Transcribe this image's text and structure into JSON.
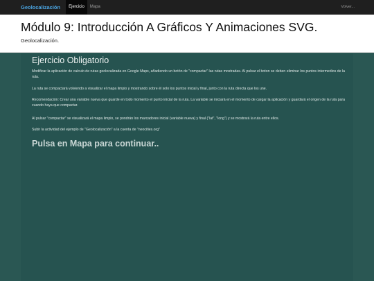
{
  "navbar": {
    "brand": "Geolocalización",
    "tabs": [
      {
        "label": "Ejercicio",
        "active": true
      },
      {
        "label": "Mapa",
        "active": false
      }
    ],
    "right_link": "Volver..."
  },
  "header": {
    "title": "Módulo 9: Introducción A Gráficos Y Animaciones SVG.",
    "subtitle": "Geolocalización."
  },
  "exercise": {
    "title": "Ejercicio Obligatorio",
    "paragraphs": [
      "Modificar la aplicación de calculo de rutas geolocalizada en Google Maps, añadiendo un botón de \"compactar\" las rutas mostradas. Al pulsar el boton se deben eliminar los puntos intermedios de la ruta.",
      "La ruta se compactará volviendo a visualizar el mapa limpio y mostrando sobre él solo los puntos inicial y final, junto con la ruta directa que los une.",
      "Recomendación: Crear una variable nueva que guarde en todo momento el punto inicial de la ruta. La variable se iniciará en el momento de cargar la aplicación y guardará el origen de la ruta para cuando haya que compactar.",
      "Al pulsar \"compactar\" se visualizará el mapa limpio, se pondrán los marcadores inicial (variable nueva) y final (\"lat\", \"long\") y se mostrará la ruta entre ellos.",
      "Subir la actividad del ejemplo de \"Geolocalización\" a la cuenta de \"neocities.org\""
    ],
    "call_to_action": "Pulsa en Mapa para continuar.."
  },
  "colors": {
    "navbar_bg": "#1f1f1f",
    "brand": "#4aa3df",
    "header_bg": "#ffffff",
    "content_bg": "#265350"
  }
}
